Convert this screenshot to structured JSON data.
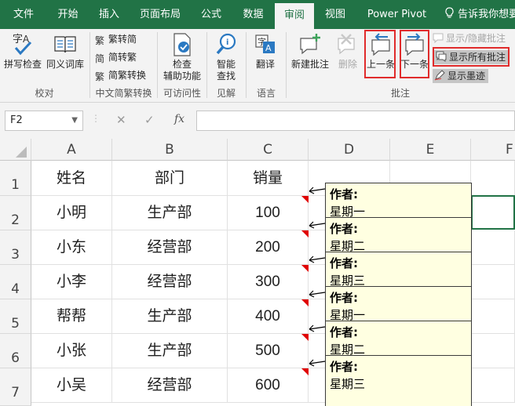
{
  "tabs": [
    "文件",
    "开始",
    "插入",
    "页面布局",
    "公式",
    "数据",
    "审阅",
    "视图",
    "Power Pivot"
  ],
  "active_tab": "审阅",
  "tell_me": "告诉我你想要",
  "ribbon": {
    "spell_check": "拼写检查",
    "thesaurus": "同义词库",
    "to_traditional": "繁转简",
    "to_simplified": "简转繁",
    "convert": "简繁转换",
    "accessibility_l1": "检查",
    "accessibility_l2": "辅助功能",
    "smart_l1": "智能",
    "smart_l2": "查找",
    "translate": "翻译",
    "new_comment": "新建批注",
    "delete": "删除",
    "previous": "上一条",
    "next": "下一条",
    "show_hide_comment": "显示/隐藏批注",
    "show_all_comments": "显示所有批注",
    "show_ink": "显示墨迹",
    "groups": {
      "proofing": "校对",
      "chinese_conversion": "中文简繁转换",
      "accessibility": "可访问性",
      "insights": "见解",
      "language": "语言",
      "comments": "批注"
    }
  },
  "name_box": "F2",
  "formula_icons": {
    "cancel": "✕",
    "enter": "✓",
    "function": "fx"
  },
  "columns": [
    "A",
    "B",
    "C",
    "D",
    "E",
    "F"
  ],
  "rows": [
    "1",
    "2",
    "3",
    "4",
    "5",
    "6",
    "7"
  ],
  "table": [
    [
      "姓名",
      "部门",
      "销量"
    ],
    [
      "小明",
      "生产部",
      "100"
    ],
    [
      "小东",
      "经营部",
      "200"
    ],
    [
      "小李",
      "经营部",
      "300"
    ],
    [
      "帮帮",
      "生产部",
      "400"
    ],
    [
      "小张",
      "生产部",
      "500"
    ],
    [
      "小吴",
      "经营部",
      "600"
    ]
  ],
  "comments": [
    {
      "author": "作者:",
      "text": "星期一"
    },
    {
      "author": "作者:",
      "text": "星期二"
    },
    {
      "author": "作者:",
      "text": "星期三"
    },
    {
      "author": "作者:",
      "text": "星期一"
    },
    {
      "author": "作者:",
      "text": "星期二"
    },
    {
      "author": "作者:",
      "text": "星期三"
    }
  ],
  "colors": {
    "excel_green": "#217346",
    "highlight_red": "#e02b2b",
    "comment_bg": "#ffffe1",
    "comment_indicator": "#e00000"
  }
}
